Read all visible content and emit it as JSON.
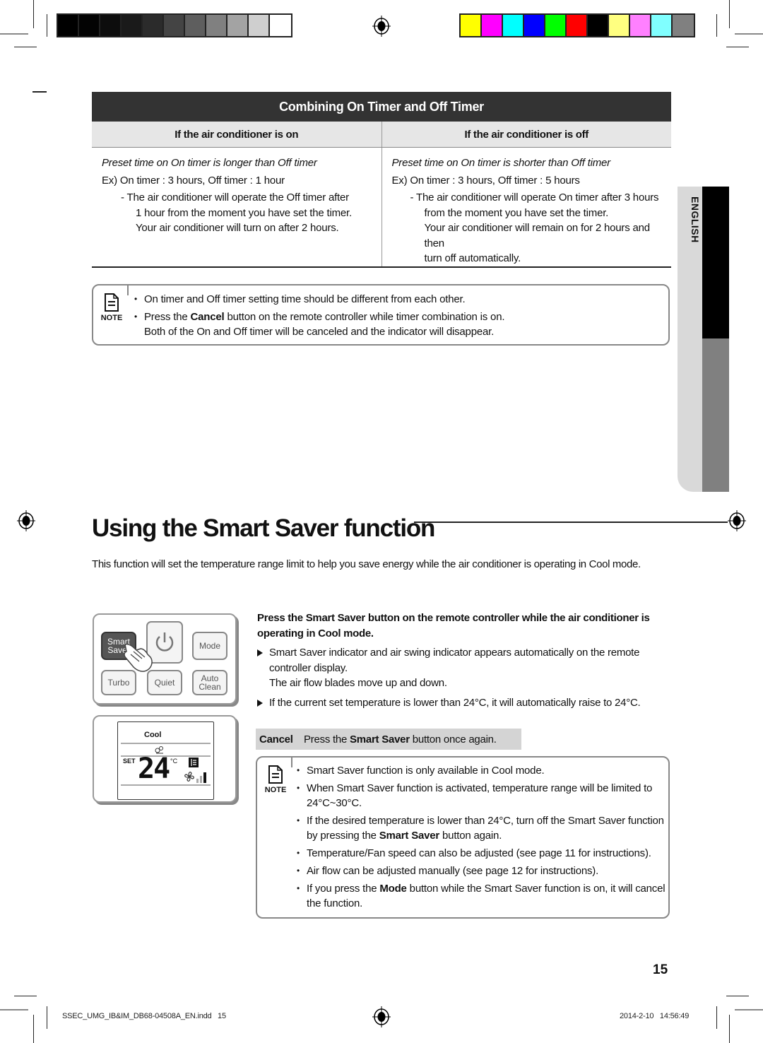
{
  "print_marks": {
    "grey_swatches": [
      "#000000",
      "#030303",
      "#0d0d0d",
      "#1a1a1a",
      "#2b2b2b",
      "#444444",
      "#5e5e5e",
      "#808080",
      "#a3a3a3",
      "#cfcfcf",
      "#ffffff"
    ],
    "color_swatches": [
      "#ffff00",
      "#ff00ff",
      "#00ffff",
      "#0000ff",
      "#00ff00",
      "#ff0000",
      "#000000",
      "#ffff80",
      "#ff80ff",
      "#80ffff",
      "#808080"
    ]
  },
  "timer_table": {
    "title": "Combining On Timer and Off Timer",
    "columns": [
      {
        "header": "If the air conditioner is on",
        "case": "Preset time on On timer is longer than Off timer",
        "example": "Ex) On timer : 3 hours, Off timer : 1 hour",
        "details": [
          "- The air conditioner will operate the Off timer after",
          "1 hour from the moment you have set the timer.",
          "Your air conditioner will turn on after 2 hours."
        ]
      },
      {
        "header": "If the air conditioner is off",
        "case": "Preset time on On timer is shorter than Off timer",
        "example": "Ex) On timer : 3 hours, Off timer : 5 hours",
        "details": [
          "- The air conditioner will operate On timer after 3 hours",
          "from the moment you have set the timer.",
          "Your air conditioner will remain on for 2 hours and then",
          "turn off automatically."
        ]
      }
    ]
  },
  "note1": {
    "label": "NOTE",
    "items": [
      {
        "pre": "On timer and Off timer setting time should be different from each other.",
        "bold": "",
        "post": ""
      },
      {
        "pre": "Press the ",
        "bold": "Cancel",
        "post": " button on the remote controller while timer combination is on."
      },
      {
        "pre": "Both of the On and Off timer will be canceled and the indicator will disappear.",
        "bold": "",
        "post": "",
        "continuation": true
      }
    ]
  },
  "side_tab": {
    "language": "ENGLISH"
  },
  "section": {
    "title": "Using the Smart Saver function",
    "intro": "This function will set the temperature range limit to help you save energy while the air conditioner is operating in Cool mode."
  },
  "remote_buttons": {
    "smart_saver": [
      "Smart",
      "Saver"
    ],
    "power": "power",
    "mode": "Mode",
    "turbo": "Turbo",
    "quiet": "Quiet",
    "auto_clean": [
      "Auto",
      "Clean"
    ]
  },
  "remote_display": {
    "mode": "Cool",
    "set_label": "SET",
    "temperature": "24",
    "unit": "°C"
  },
  "instructions": {
    "lead_pre": "Press the ",
    "lead_bold": "Smart Saver",
    "lead_post": " button on the remote controller while the air conditioner is operating in Cool mode.",
    "steps": [
      {
        "line1": "Smart Saver indicator and air swing indicator appears automatically on the remote controller display.",
        "line2": "The air flow blades move up and down."
      },
      {
        "line1": "If the current set temperature is lower than 24°C, it will automatically raise to 24°C.",
        "line2": ""
      }
    ]
  },
  "cancel": {
    "label": "Cancel",
    "pre": "Press the ",
    "bold": "Smart Saver",
    "post": " button once again."
  },
  "note2": {
    "label": "NOTE",
    "items": [
      {
        "pre": "Smart Saver function is only available in Cool mode.",
        "bold": "",
        "post": ""
      },
      {
        "pre": "When Smart Saver function is activated, temperature range will be limited to 24°C~30°C.",
        "bold": "",
        "post": ""
      },
      {
        "pre": "If the desired temperature is lower than 24°C, turn off the Smart Saver function by pressing the ",
        "bold": "Smart Saver",
        "post": " button again."
      },
      {
        "pre": "Temperature/Fan speed can also be adjusted (see page 11 for instructions).",
        "bold": "",
        "post": ""
      },
      {
        "pre": "Air flow can be adjusted manually (see page 12 for instructions).",
        "bold": "",
        "post": ""
      },
      {
        "pre": "If you press the ",
        "bold": "Mode",
        "post": " button while the Smart Saver function is on, it will cancel the function."
      }
    ]
  },
  "page_number": "15",
  "footer": {
    "file": "SSEC_UMG_IB&IM_DB68-04508A_EN.indd   15",
    "timestamp": "2014-2-10   14:56:49"
  }
}
